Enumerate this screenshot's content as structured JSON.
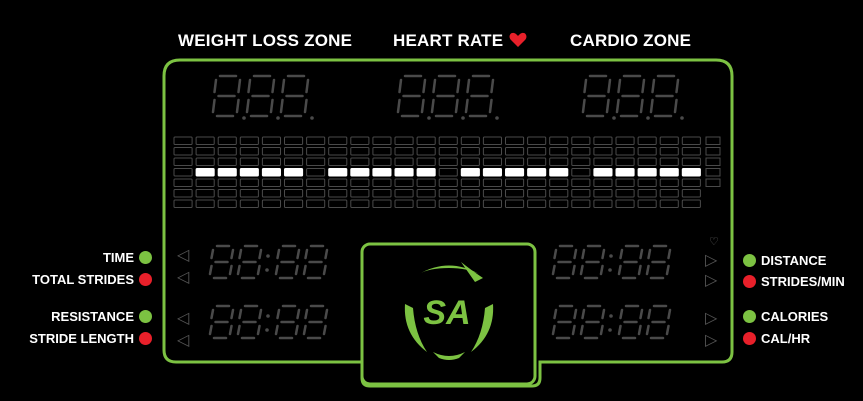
{
  "zones": {
    "weight_loss_label": "WEIGHT LOSS ZONE",
    "heart_rate_label": "HEART RATE",
    "cardio_label": "CARDIO ZONE"
  },
  "labels_left": [
    {
      "text": "TIME",
      "color": "#7cc242"
    },
    {
      "text": "TOTAL STRIDES",
      "color": "#e8202a"
    },
    {
      "text": "RESISTANCE",
      "color": "#7cc242"
    },
    {
      "text": "STRIDE LENGTH",
      "color": "#e8202a"
    }
  ],
  "labels_right": [
    {
      "text": "DISTANCE",
      "color": "#7cc242"
    },
    {
      "text": "STRIDES/MIN",
      "color": "#e8202a"
    },
    {
      "text": "CALORIES",
      "color": "#7cc242"
    },
    {
      "text": "CAL/HR",
      "color": "#e8202a"
    }
  ],
  "theme": {
    "frame_green": "#7cc242",
    "heart_red": "#e8202a",
    "segment_dim": "#4a4a4a",
    "segment_lit": "#ffffff"
  },
  "logo": {
    "icon": "sa-logo-icon"
  },
  "bar_matrix": {
    "lit_row": 3
  }
}
